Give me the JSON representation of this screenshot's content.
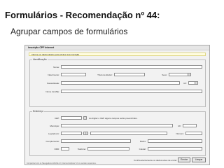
{
  "slide": {
    "title": "Formulários - Recomendação nº 44:",
    "subtitle": "Agrupar campos de formulários"
  },
  "form": {
    "window_title": "Inscrição CPF Internet",
    "info_text": "Informe os dados abaixo para efetuar sua inscrição",
    "sections": {
      "identificacao": {
        "legend": "Identificação",
        "labels": {
          "nome": "Nome:",
          "nascimento": "Nascimento:",
          "titulo_eleitor": "Título de Eleitor:",
          "sexo": "Sexo:",
          "naturalidade": "Naturalidade:",
          "uf": "UF:",
          "nome_mae": "Nome da Mãe:"
        }
      },
      "endereco": {
        "legend": "Endereço",
        "labels": {
          "cep": "CEP:",
          "municipio": "Município:",
          "uf": "UF:",
          "logradouro": "Logradouro:",
          "numero": "Número:",
          "complemento": "Complemento:",
          "bairro": "Bairro:",
          "ddd": "DDD:",
          "telefone": "Telefone:",
          "celular": "Celular:"
        },
        "cep_hint": "Ao digitar o CEP alguns campos serão preenchidos."
      }
    },
    "footer_note": "Confira atentamente os dados antes de enviar",
    "buttons": {
      "send": "Enviar",
      "clear": "Limpar"
    },
    "compat_note": "Compatível com os Navegadores Mozilla 2.0, Internet Explorer 6.0 ou versões superiores."
  }
}
